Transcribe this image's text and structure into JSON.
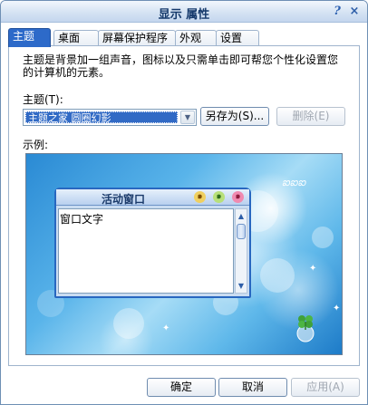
{
  "window": {
    "title": "显示 属性",
    "help_label": "?",
    "close_label": "×"
  },
  "tabs": [
    {
      "label": "主题",
      "active": true
    },
    {
      "label": "桌面",
      "active": false
    },
    {
      "label": "屏幕保护程序",
      "active": false
    },
    {
      "label": "外观",
      "active": false
    },
    {
      "label": "设置",
      "active": false
    }
  ],
  "theme_tab": {
    "description": "主题是背景加一组声音，图标以及只需单击即可帮您个性化设置您的计算机的元素。",
    "theme_label": "主题(T):",
    "selected_theme": "主题之家 圆圈幻影",
    "save_as_label": "另存为(S)...",
    "delete_label": "删除(E)",
    "sample_label": "示例:"
  },
  "preview": {
    "active_window_title": "活动窗口",
    "window_text": "窗口文字",
    "wallpaper_text": "ఐఐఐ"
  },
  "buttons": {
    "ok": "确定",
    "cancel": "取消",
    "apply": "应用(A)"
  },
  "colors": {
    "selection": "#316ac5",
    "active_tab": "#2d6ac9",
    "window_border": "#2867c0"
  },
  "icons": [
    "help-icon",
    "close-icon",
    "dropdown-arrow-icon",
    "minimize-icon",
    "maximize-icon",
    "window-close-icon",
    "scroll-up-icon",
    "scroll-down-icon",
    "clover-icon"
  ]
}
